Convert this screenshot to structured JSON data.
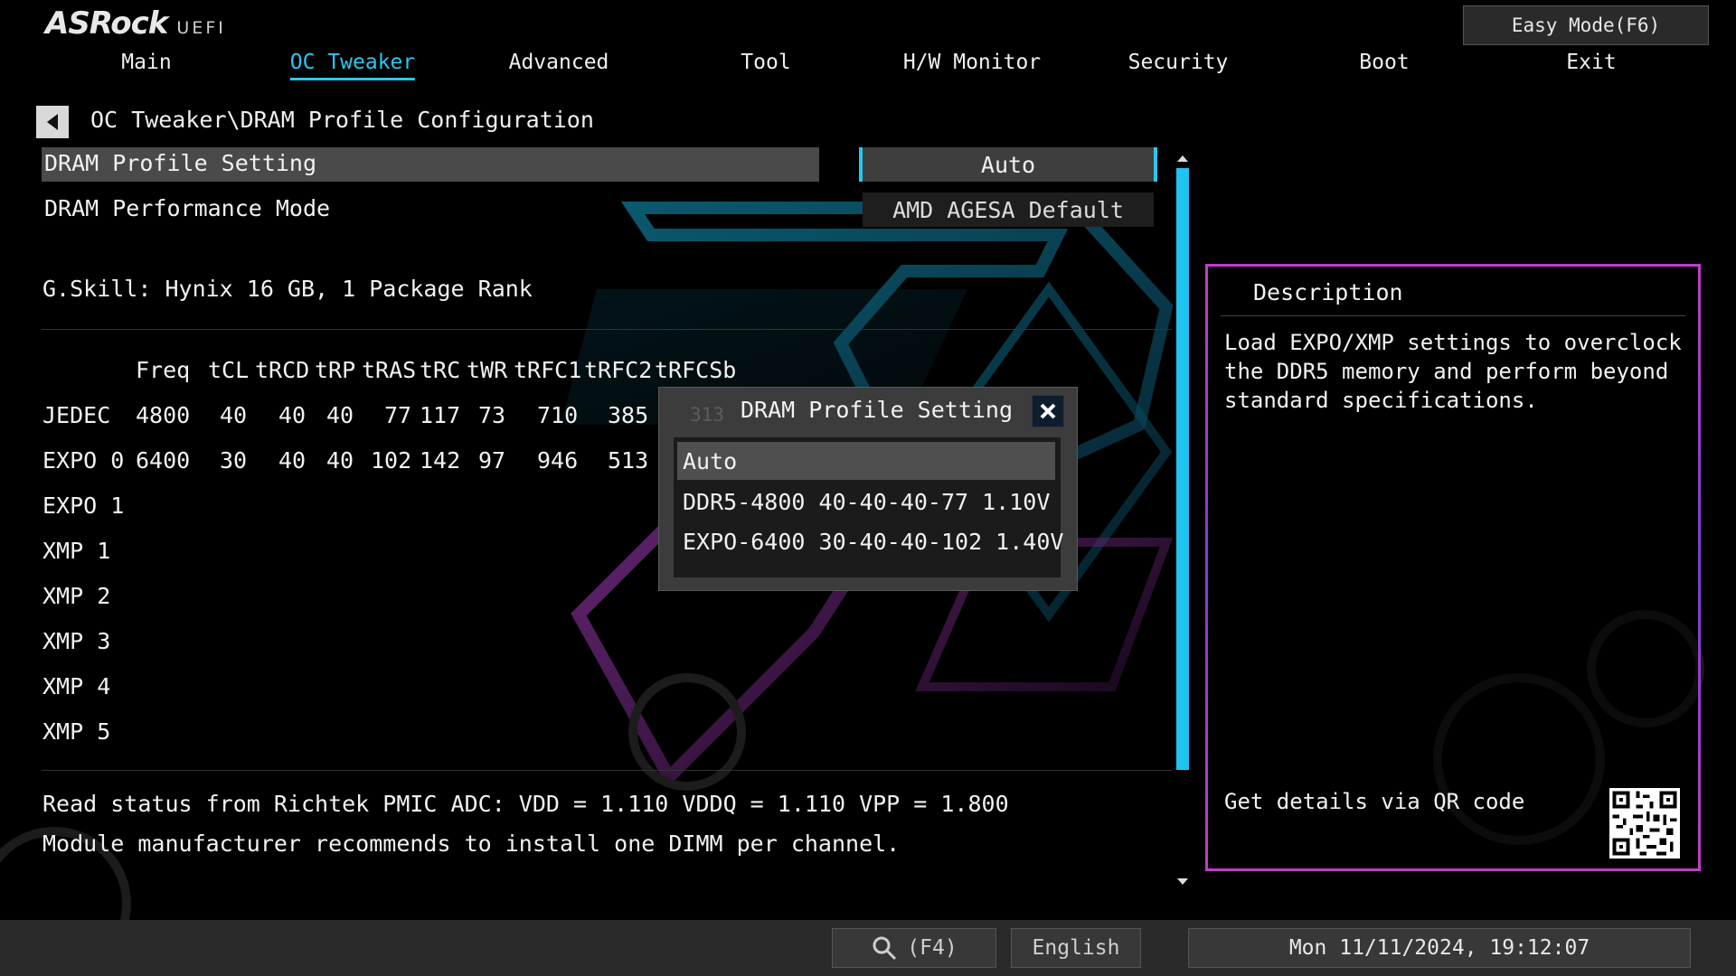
{
  "header": {
    "logo_main": "ASRock",
    "logo_sub": "UEFI",
    "easy_mode": "Easy Mode(F6)"
  },
  "tabs": [
    {
      "label": "Main"
    },
    {
      "label": "OC Tweaker",
      "active": true
    },
    {
      "label": "Advanced"
    },
    {
      "label": "Tool"
    },
    {
      "label": "H/W Monitor"
    },
    {
      "label": "Security"
    },
    {
      "label": "Boot"
    },
    {
      "label": "Exit"
    }
  ],
  "breadcrumb": "OC Tweaker\\DRAM Profile Configuration",
  "settings": {
    "profile": {
      "label": "DRAM Profile Setting",
      "value": "Auto"
    },
    "performance": {
      "label": "DRAM Performance Mode",
      "value": "AMD AGESA Default"
    }
  },
  "module_info": "G.Skill: Hynix 16 GB, 1 Package Rank",
  "timing_table": {
    "headers": [
      "Freq",
      "tCL",
      "tRCD",
      "tRP",
      "tRAS",
      "tRC",
      "tWR",
      "tRFC1",
      "tRFC2",
      "tRFCSb"
    ],
    "rows": [
      {
        "name": "JEDEC",
        "values": [
          "4800",
          "40",
          "40",
          "40",
          "77",
          "117",
          "73",
          "710",
          "385",
          ""
        ]
      },
      {
        "name": "EXPO 0",
        "values": [
          "6400",
          "30",
          "40",
          "40",
          "102",
          "142",
          "97",
          "946",
          "513",
          ""
        ]
      },
      {
        "name": "EXPO 1",
        "values": [
          "",
          "",
          "",
          "",
          "",
          "",
          "",
          "",
          "",
          ""
        ]
      },
      {
        "name": "XMP 1",
        "values": [
          "",
          "",
          "",
          "",
          "",
          "",
          "",
          "",
          "",
          ""
        ]
      },
      {
        "name": "XMP 2",
        "values": [
          "",
          "",
          "",
          "",
          "",
          "",
          "",
          "",
          "",
          ""
        ]
      },
      {
        "name": "XMP 3",
        "values": [
          "",
          "",
          "",
          "",
          "",
          "",
          "",
          "",
          "",
          ""
        ]
      },
      {
        "name": "XMP 4",
        "values": [
          "",
          "",
          "",
          "",
          "",
          "",
          "",
          "",
          "",
          ""
        ]
      },
      {
        "name": "XMP 5",
        "values": [
          "",
          "",
          "",
          "",
          "",
          "",
          "",
          "",
          "",
          ""
        ]
      }
    ]
  },
  "status": {
    "pmic": "Read status from Richtek PMIC ADC: VDD = 1.110 VDDQ = 1.110 VPP = 1.800",
    "note": "Module manufacturer recommends to install one DIMM per channel."
  },
  "popup": {
    "title": "DRAM Profile Setting",
    "ghost_value": "313",
    "options": [
      "Auto",
      "DDR5-4800 40-40-40-77 1.10V",
      "EXPO-6400 30-40-40-102 1.40V"
    ],
    "selected": "Auto"
  },
  "description": {
    "title": "Description",
    "text": "Load EXPO/XMP settings to overclock the DDR5 memory and perform beyond standard specifications.",
    "qr_text": "Get details via QR code"
  },
  "footer": {
    "search_key": "(F4)",
    "language": "English",
    "datetime": "Mon 11/11/2024, 19:12:07"
  },
  "colors": {
    "accent": "#27c8f0",
    "panel_border": "#c23cc8",
    "background": "#000000"
  }
}
